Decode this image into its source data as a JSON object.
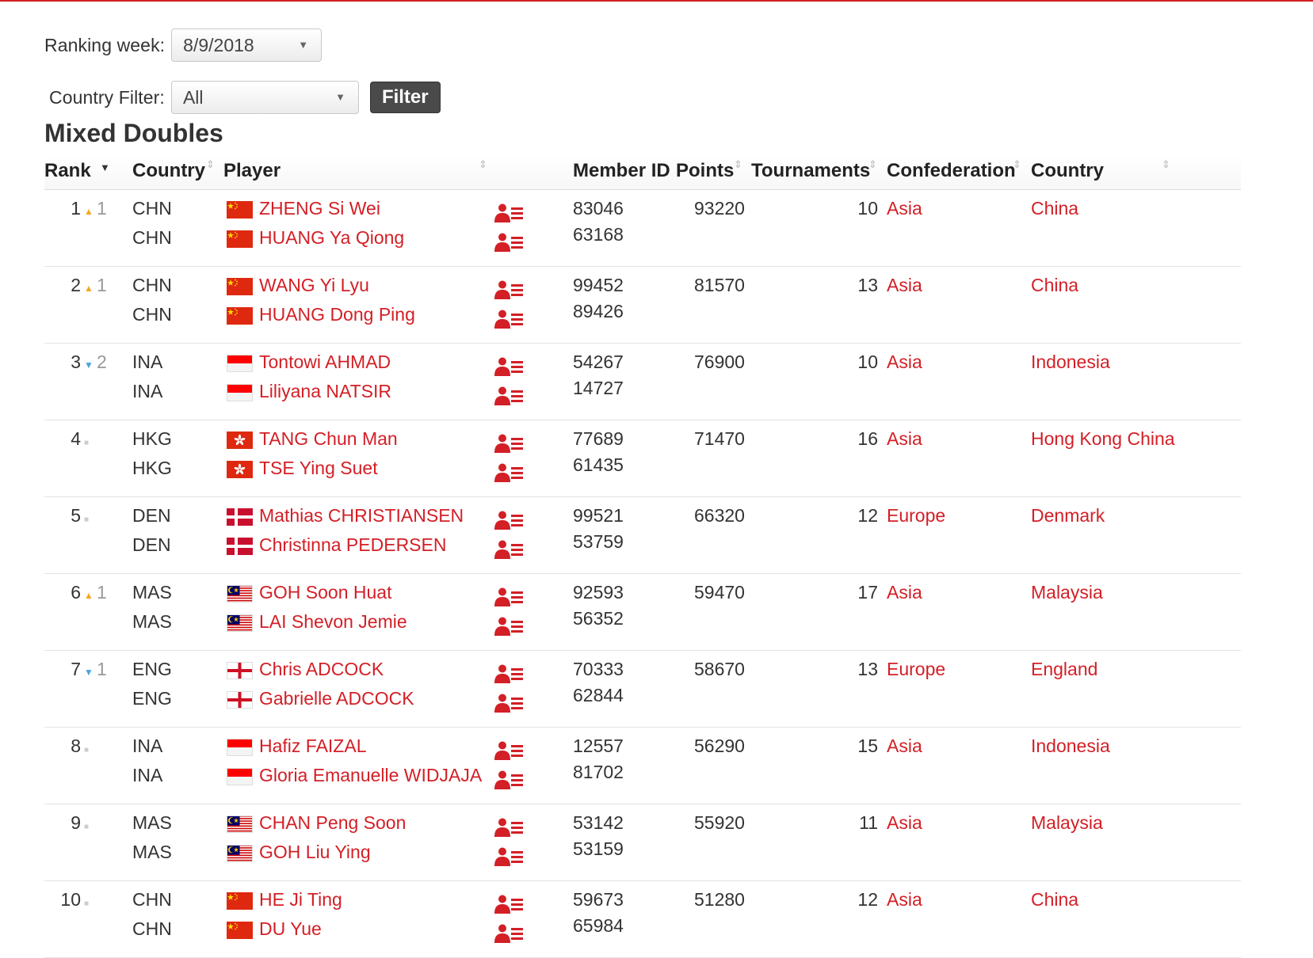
{
  "filters": {
    "week_label": "Ranking week:",
    "week_value": "8/9/2018",
    "country_label": "Country Filter:",
    "country_value": "All",
    "filter_button": "Filter"
  },
  "title": "Mixed Doubles",
  "columns": {
    "rank": "Rank",
    "country": "Country",
    "player": "Player",
    "member_id": "Member ID",
    "points": "Points",
    "tournaments": "Tournaments",
    "confederation": "Confederation",
    "country_name": "Country"
  },
  "colors": {
    "accent": "#d31f26",
    "up": "#f5a623",
    "down": "#4aa3df",
    "button": "#4a4a4a"
  },
  "icons": {
    "up": "rank-up-icon",
    "down": "rank-down-icon",
    "same": "rank-same-icon",
    "profile": "player-profile-icon"
  },
  "rows": [
    {
      "rank": "1",
      "move": "up",
      "move_val": "1",
      "points": "93220",
      "tournaments": "10",
      "confederation": "Asia",
      "country_name": "China",
      "players": [
        {
          "code": "CHN",
          "flag": "chn",
          "name": "ZHENG Si Wei",
          "member_id": "83046"
        },
        {
          "code": "CHN",
          "flag": "chn",
          "name": "HUANG Ya Qiong",
          "member_id": "63168"
        }
      ]
    },
    {
      "rank": "2",
      "move": "up",
      "move_val": "1",
      "points": "81570",
      "tournaments": "13",
      "confederation": "Asia",
      "country_name": "China",
      "players": [
        {
          "code": "CHN",
          "flag": "chn",
          "name": "WANG Yi Lyu",
          "member_id": "99452"
        },
        {
          "code": "CHN",
          "flag": "chn",
          "name": "HUANG Dong Ping",
          "member_id": "89426"
        }
      ]
    },
    {
      "rank": "3",
      "move": "down",
      "move_val": "2",
      "points": "76900",
      "tournaments": "10",
      "confederation": "Asia",
      "country_name": "Indonesia",
      "players": [
        {
          "code": "INA",
          "flag": "ina",
          "name": "Tontowi AHMAD",
          "member_id": "54267"
        },
        {
          "code": "INA",
          "flag": "ina",
          "name": "Liliyana NATSIR",
          "member_id": "14727"
        }
      ]
    },
    {
      "rank": "4",
      "move": "same",
      "move_val": "",
      "points": "71470",
      "tournaments": "16",
      "confederation": "Asia",
      "country_name": "Hong Kong China",
      "players": [
        {
          "code": "HKG",
          "flag": "hkg",
          "name": "TANG Chun Man",
          "member_id": "77689"
        },
        {
          "code": "HKG",
          "flag": "hkg",
          "name": "TSE Ying Suet",
          "member_id": "61435"
        }
      ]
    },
    {
      "rank": "5",
      "move": "same",
      "move_val": "",
      "points": "66320",
      "tournaments": "12",
      "confederation": "Europe",
      "country_name": "Denmark",
      "players": [
        {
          "code": "DEN",
          "flag": "den",
          "name": "Mathias CHRISTIANSEN",
          "member_id": "99521"
        },
        {
          "code": "DEN",
          "flag": "den",
          "name": "Christinna PEDERSEN",
          "member_id": "53759"
        }
      ]
    },
    {
      "rank": "6",
      "move": "up",
      "move_val": "1",
      "points": "59470",
      "tournaments": "17",
      "confederation": "Asia",
      "country_name": "Malaysia",
      "players": [
        {
          "code": "MAS",
          "flag": "mas",
          "name": "GOH Soon Huat",
          "member_id": "92593"
        },
        {
          "code": "MAS",
          "flag": "mas",
          "name": "LAI Shevon Jemie",
          "member_id": "56352"
        }
      ]
    },
    {
      "rank": "7",
      "move": "down",
      "move_val": "1",
      "points": "58670",
      "tournaments": "13",
      "confederation": "Europe",
      "country_name": "England",
      "players": [
        {
          "code": "ENG",
          "flag": "eng",
          "name": "Chris ADCOCK",
          "member_id": "70333"
        },
        {
          "code": "ENG",
          "flag": "eng",
          "name": "Gabrielle ADCOCK",
          "member_id": "62844"
        }
      ]
    },
    {
      "rank": "8",
      "move": "same",
      "move_val": "",
      "points": "56290",
      "tournaments": "15",
      "confederation": "Asia",
      "country_name": "Indonesia",
      "players": [
        {
          "code": "INA",
          "flag": "ina",
          "name": "Hafiz FAIZAL",
          "member_id": "12557"
        },
        {
          "code": "INA",
          "flag": "ina",
          "name": "Gloria Emanuelle WIDJAJA",
          "member_id": "81702"
        }
      ]
    },
    {
      "rank": "9",
      "move": "same",
      "move_val": "",
      "points": "55920",
      "tournaments": "11",
      "confederation": "Asia",
      "country_name": "Malaysia",
      "players": [
        {
          "code": "MAS",
          "flag": "mas",
          "name": "CHAN Peng Soon",
          "member_id": "53142"
        },
        {
          "code": "MAS",
          "flag": "mas",
          "name": "GOH Liu Ying",
          "member_id": "53159"
        }
      ]
    },
    {
      "rank": "10",
      "move": "same",
      "move_val": "",
      "points": "51280",
      "tournaments": "12",
      "confederation": "Asia",
      "country_name": "China",
      "players": [
        {
          "code": "CHN",
          "flag": "chn",
          "name": "HE Ji Ting",
          "member_id": "59673"
        },
        {
          "code": "CHN",
          "flag": "chn",
          "name": "DU Yue",
          "member_id": "65984"
        }
      ]
    }
  ]
}
